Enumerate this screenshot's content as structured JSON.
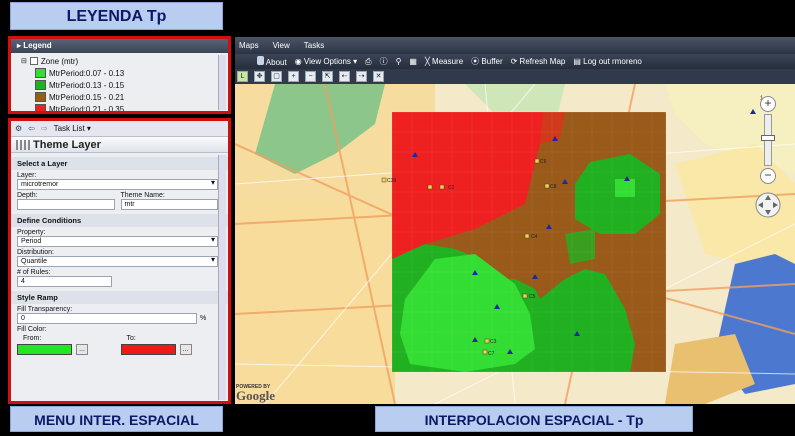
{
  "callouts": {
    "legend_title": "LEYENDA Tp",
    "menu_title": "MENU INTER. ESPACIAL",
    "map_title": "INTERPOLACION ESPACIAL - Tp"
  },
  "legend": {
    "header": "Legend",
    "layer_name": "Zone (mtr)",
    "items": [
      {
        "label": "MtrPeriod:0.07 - 0.13",
        "color": "#33dd33"
      },
      {
        "label": "MtrPeriod:0.13 - 0.15",
        "color": "#20b020"
      },
      {
        "label": "MtrPeriod:0.15 - 0.21",
        "color": "#9a5a1a"
      },
      {
        "label": "MtrPeriod:0.21 - 0.35",
        "color": "#ee2020"
      }
    ]
  },
  "menu": {
    "task_list": "Task List",
    "panel_title": "Theme Layer",
    "select_layer": {
      "section": "Select a Layer",
      "layer_label": "Layer:",
      "layer_value": "microtremor",
      "depth_label": "Depth:",
      "depth_value": "",
      "theme_name_label": "Theme Name:",
      "theme_name_value": "mtr"
    },
    "conditions": {
      "section": "Define Conditions",
      "property_label": "Property:",
      "property_value": "Period",
      "distribution_label": "Distribution:",
      "distribution_value": "Quantile",
      "rules_label": "# of Rules:",
      "rules_value": "4"
    },
    "style_ramp": {
      "section": "Style Ramp",
      "transparency_label": "Fill Transparency:",
      "transparency_value": "0",
      "transparency_unit": "%",
      "fill_color_label": "Fill Color:",
      "from_label": "From:",
      "to_label": "To:",
      "from_color": "#22e622",
      "to_color": "#ee1a1a",
      "more_label": "..."
    }
  },
  "app": {
    "menu_items": [
      "Maps",
      "View",
      "Tasks"
    ],
    "toolbar": {
      "about": "About",
      "view_options": "View Options",
      "measure": "Measure",
      "buffer": "Buffer",
      "refresh": "Refresh Map",
      "logout": "Log out rmoreno"
    }
  },
  "map": {
    "attribution": "Google",
    "powered_by": "POWERED BY",
    "scale_label": "1",
    "markers": [
      "C39",
      "C8",
      "C4",
      "C5",
      "C3",
      "C7",
      "C6",
      "C2"
    ]
  }
}
